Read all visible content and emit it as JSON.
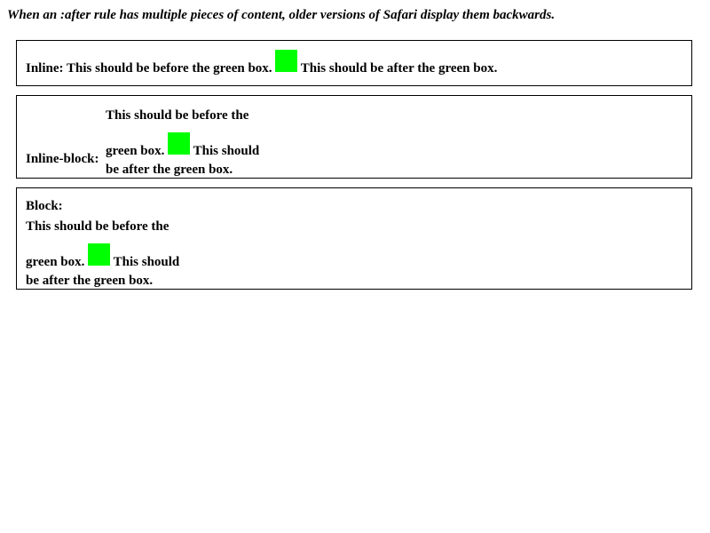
{
  "title": "When an :after rule has multiple pieces of content, older versions of Safari display them backwards.",
  "colors": {
    "green_box": "#00ff00",
    "border": "#000000"
  },
  "inline": {
    "label": "Inline:",
    "before": "This should be before the green box.",
    "after": "This should be after the green box."
  },
  "inline_block": {
    "label": "Inline-block:",
    "line1": "This should be before the",
    "line2_before": "green box.",
    "line2_after": "This should",
    "line3": "be after the green box."
  },
  "block": {
    "label": "Block:",
    "line1": "This should be before the",
    "line2_before": "green box.",
    "line2_after": "This should",
    "line3": "be after the green box."
  }
}
